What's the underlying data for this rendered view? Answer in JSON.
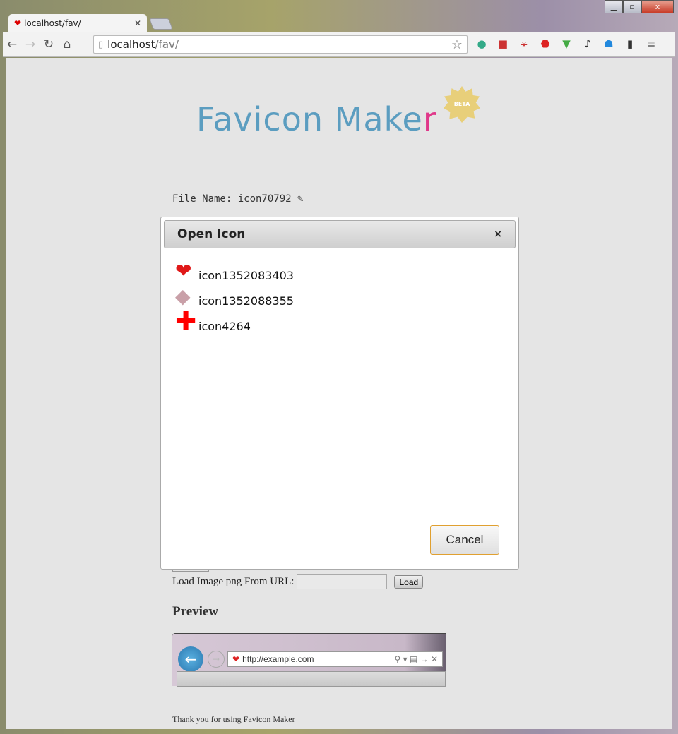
{
  "browser": {
    "tab_title": "localhost/fav/",
    "url_host": "localhost",
    "url_path": "/fav/",
    "window_buttons": {
      "minimize": "▁",
      "maximize": "▫",
      "close": "x"
    },
    "extension_icons": [
      "globe-icon",
      "book-icon",
      "network-icon",
      "stop-icon",
      "download-icon",
      "tool-icon",
      "ghost-icon",
      "phone-icon"
    ]
  },
  "page": {
    "logo_text": "Favicon Make",
    "logo_last": "r",
    "beta": "BETA",
    "file_name_label": "File Name: icon70792",
    "load_url_label": "Load Image png From URL:",
    "load_url_value": "",
    "load_button": "Load",
    "preview_heading": "Preview",
    "preview_url": "http://example.com",
    "footer": "Thank you for using Favicon Maker"
  },
  "dialog": {
    "title": "Open Icon",
    "close": "×",
    "cancel": "Cancel",
    "items": [
      {
        "name": "icon1352083403",
        "icon": "heart-icon"
      },
      {
        "name": "icon1352088355",
        "icon": "eraser-icon"
      },
      {
        "name": "icon4264",
        "icon": "red-cross-icon"
      }
    ]
  },
  "colors": {
    "logo": "#5b9dc0",
    "logo_accent": "#e0388a",
    "cancel_border": "#e0a030"
  }
}
